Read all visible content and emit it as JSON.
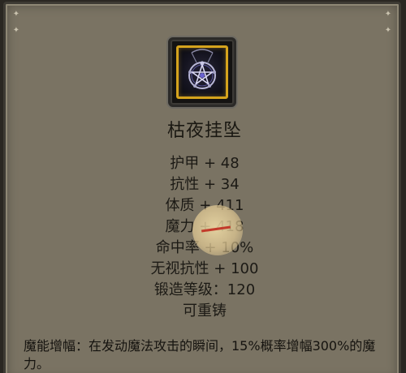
{
  "item": {
    "name": "枯夜挂坠",
    "icon": "pentagram-pendant-icon",
    "frame_color": "#d5a31d"
  },
  "stats": [
    "护甲 + 48",
    "抗性 + 34",
    "体质 + 411",
    "魔力 + 418",
    "命中率 + 10%",
    "无视抗性 + 100",
    "锻造等级：120",
    "可重铸"
  ],
  "description": "魔能增幅：在发动魔法攻击的瞬间，15%概率增幅300%的魔力。",
  "colors": {
    "panel_bg": "#7a7363",
    "text": "#1c1a15",
    "accent_gold": "#d5a31d"
  }
}
